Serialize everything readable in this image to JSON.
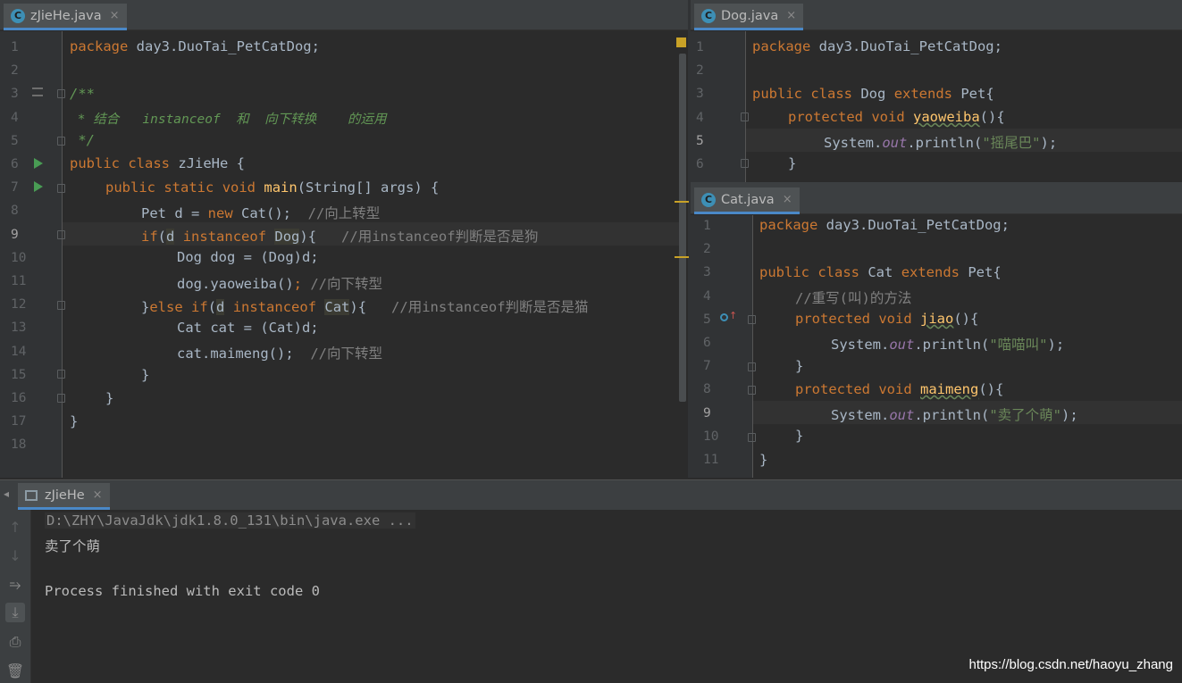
{
  "left_editor": {
    "tab": {
      "icon": "c-class-icon",
      "label": "zJieHe.java",
      "close": "×"
    },
    "lines": [
      "1",
      "2",
      "3",
      "4",
      "5",
      "6",
      "7",
      "8",
      "9",
      "10",
      "11",
      "12",
      "13",
      "14",
      "15",
      "16",
      "17",
      "18"
    ],
    "current_line": "9"
  },
  "dog_editor": {
    "tab": {
      "icon": "c-class-icon",
      "label": "Dog.java",
      "close": "×"
    },
    "lines": [
      "1",
      "2",
      "3",
      "4",
      "5",
      "6"
    ],
    "current_line": "5"
  },
  "cat_editor": {
    "tab": {
      "icon": "c-class-icon",
      "label": "Cat.java",
      "close": "×"
    },
    "lines": [
      "1",
      "2",
      "3",
      "4",
      "5",
      "6",
      "7",
      "8",
      "9",
      "10",
      "11"
    ],
    "current_line": "9"
  },
  "code_tokens": {
    "package": "package",
    "pkg_name": " day3.DuoTai_PetCatDog;",
    "doc_open": "/**",
    "doc_line": " * 结合   instanceof  和  向下转换    的运用",
    "doc_close": " */",
    "public": "public",
    "class": "class",
    "static": "static",
    "void": "void",
    "protected": "protected",
    "extends": "extends",
    "new": "new",
    "if": "if",
    "else": "else",
    "instanceof": "instanceof",
    "zjiehe_name": " zJieHe {",
    "main": "main",
    "main_args": "(String[] args) {",
    "pet_d": "Pet d = ",
    "cat_new": " Cat();",
    "c_up": "  //向上转型",
    "if_open": "(",
    "d": "d",
    "dog_type": "Dog",
    "cat_type": "Cat",
    "if_close": "){",
    "c_isdog": "   //用instanceof判断是否是狗",
    "dog_cast": "Dog dog = (Dog)d;",
    "dog_call_a": "dog.yaoweiba()",
    "semi": ";",
    "c_down": " //向下转型",
    "c_down2": "  //向下转型",
    "close_brace": "}",
    "c_iscat": "   //用instanceof判断是否是猫",
    "cat_cast": "Cat cat = (Cat)d;",
    "cat_call": "cat.maimeng();",
    "dog_class": " Dog ",
    "cat_class": " Cat ",
    "pet_open": " Pet{",
    "yaoweiba": "yaoweiba",
    "jiao": "jiao",
    "maimeng": "maimeng",
    "paren_open": "(){",
    "sys": "System.",
    "out": "out",
    "println": ".println(",
    "s_yaoweiba": "\"摇尾巴\"",
    "s_miao": "\"喵喵叫\"",
    "s_maimeng": "\"卖了个萌\"",
    "end_call": ");",
    "c_override": "//重写(叫)的方法"
  },
  "run_window": {
    "tab": {
      "icon": "console-icon",
      "label": "zJieHe",
      "close": "×"
    },
    "output": [
      "D:\\ZHY\\JavaJdk\\jdk1.8.0_131\\bin\\java.exe ...",
      "卖了个萌",
      "",
      "Process finished with exit code 0"
    ],
    "sidebar_icons": [
      "arrow-up-icon",
      "arrow-down-icon",
      "soft-wrap-icon",
      "scroll-to-end-icon",
      "print-icon",
      "trash-icon"
    ]
  },
  "watermark": "https://blog.csdn.net/haoyu_zhang",
  "colors": {
    "background": "#2b2b2b",
    "keyword": "#cc7832",
    "function": "#ffc66d",
    "comment": "#808080",
    "doc_comment": "#629755",
    "string": "#6a8759",
    "static_field": "#9876aa",
    "text": "#a9b7c6"
  }
}
